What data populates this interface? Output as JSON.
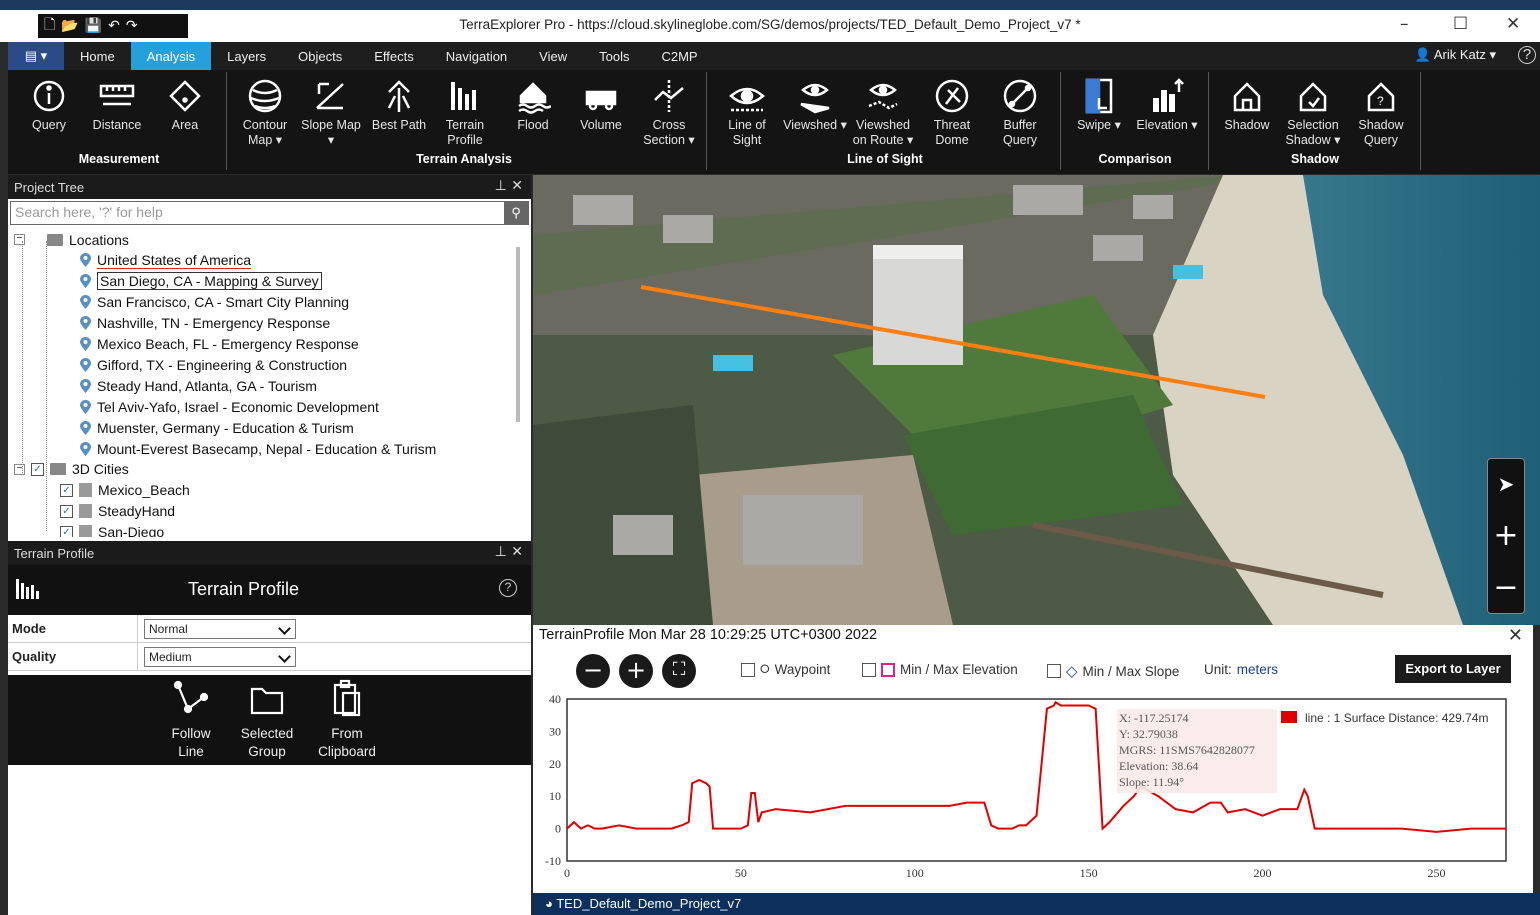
{
  "window": {
    "title": "TerraExplorer Pro - https://cloud.skylineglobe.com/SG/demos/projects/TED_Default_Demo_Project_v7 *",
    "user": "Arik Katz",
    "help": "?"
  },
  "menu": [
    "Home",
    "Analysis",
    "Layers",
    "Objects",
    "Effects",
    "Navigation",
    "View",
    "Tools",
    "C2MP"
  ],
  "ribbon": {
    "buttons": [
      {
        "label": "Query",
        "icon": "info-icon"
      },
      {
        "label": "Distance",
        "icon": "ruler-icon"
      },
      {
        "label": "Area",
        "icon": "area-icon"
      },
      {
        "label": "Contour Map ▾",
        "icon": "contour-icon"
      },
      {
        "label": "Slope Map ▾",
        "icon": "slope-icon"
      },
      {
        "label": "Best Path",
        "icon": "path-icon"
      },
      {
        "label": "Terrain Profile",
        "icon": "profile-icon"
      },
      {
        "label": "Flood",
        "icon": "flood-icon"
      },
      {
        "label": "Volume",
        "icon": "volume-icon"
      },
      {
        "label": "Cross Section ▾",
        "icon": "cross-section-icon"
      },
      {
        "label": "Line of Sight",
        "icon": "eye-icon"
      },
      {
        "label": "Viewshed ▾",
        "icon": "viewshed-icon"
      },
      {
        "label": "Viewshed on Route ▾",
        "icon": "viewshed-route-icon"
      },
      {
        "label": "Threat Dome",
        "icon": "threat-dome-icon"
      },
      {
        "label": "Buffer Query",
        "icon": "buffer-icon"
      },
      {
        "label": "Swipe ▾",
        "icon": "swipe-icon"
      },
      {
        "label": "Elevation ▾",
        "icon": "elevation-icon"
      },
      {
        "label": "Shadow",
        "icon": "shadow-icon"
      },
      {
        "label": "Selection Shadow ▾",
        "icon": "selection-shadow-icon"
      },
      {
        "label": "Shadow Query",
        "icon": "shadow-query-icon"
      }
    ],
    "groups": [
      "Measurement",
      "Terrain Analysis",
      "Line of Sight",
      "Comparison",
      "Shadow"
    ]
  },
  "project_tree": {
    "title": "Project Tree",
    "search_placeholder": "Search here, '?' for help",
    "items": [
      "Locations",
      "United States of America",
      "San Diego, CA - Mapping & Survey",
      "San Francisco, CA - Smart City Planning",
      "Nashville, TN - Emergency Response",
      "Mexico Beach, FL - Emergency Response",
      "Gifford, TX - Engineering & Construction",
      "Steady Hand, Atlanta, GA - Tourism",
      "Tel Aviv-Yafo, Israel - Economic Development",
      "Muenster, Germany - Education & Turism",
      "Mount-Everest Basecamp, Nepal - Education & Turism",
      "3D Cities",
      "Mexico_Beach",
      "SteadyHand",
      "San-Diego"
    ]
  },
  "terrain_panel": {
    "title": "Terrain Profile",
    "heading": "Terrain Profile",
    "mode_label": "Mode",
    "mode_value": "Normal",
    "quality_label": "Quality",
    "quality_value": "Medium",
    "buttons": [
      "Follow Line",
      "Selected Group",
      "From Clipboard"
    ]
  },
  "profile": {
    "title": "TerrainProfile Mon Mar 28 10:29:25 UTC+0300 2022",
    "options": [
      "Waypoint",
      "Min / Max Elevation",
      "Min / Max Slope"
    ],
    "unit_label": "Unit:",
    "unit_value": "meters",
    "export": "Export to Layer",
    "legend": "line : 1 Surface Distance: 429.74m",
    "tooltip": [
      "X: -117.25174",
      "Y: 32.79038",
      "MGRS: 11SMS7642828077",
      "Elevation: 38.64",
      "Slope: 11.94°"
    ]
  },
  "footer": "TED_Default_Demo_Project_v7",
  "chart_data": {
    "type": "line",
    "xlim": [
      0,
      270
    ],
    "ylim": [
      -10,
      40
    ],
    "xticks": [
      "0",
      "50",
      "100",
      "150",
      "200",
      "250"
    ],
    "yticks": [
      "40",
      "30",
      "20",
      "10",
      "0",
      "-10"
    ],
    "series": [
      {
        "name": "line : 1",
        "color": "#e00000",
        "x": [
          0,
          2,
          4,
          6,
          8,
          10,
          15,
          20,
          25,
          30,
          33,
          35,
          36,
          38,
          40,
          41,
          42,
          43,
          44,
          45,
          48,
          50,
          52,
          53,
          54,
          55,
          56,
          60,
          70,
          80,
          90,
          100,
          110,
          115,
          120,
          122,
          124,
          128,
          130,
          132,
          135,
          138,
          140,
          140.5,
          142,
          145,
          148,
          150,
          152,
          154,
          156,
          160,
          163,
          165,
          170,
          175,
          180,
          185,
          188,
          190,
          195,
          200,
          205,
          210,
          212,
          213,
          215,
          220,
          230,
          240,
          250,
          260,
          270
        ],
        "y": [
          0,
          2,
          0,
          1,
          0,
          0,
          1,
          0,
          0,
          0,
          1,
          2,
          14,
          15,
          14,
          13,
          0,
          0,
          0,
          0,
          0,
          0,
          1,
          11,
          11,
          2,
          5,
          6,
          5,
          7,
          7,
          7,
          7,
          8,
          8,
          1,
          0,
          0,
          1,
          1,
          4,
          37,
          38,
          39,
          38,
          38,
          38,
          38,
          37,
          0,
          2,
          7,
          10,
          13,
          10,
          6,
          5,
          8,
          8,
          5,
          6,
          4,
          6,
          6,
          12,
          10,
          0,
          0,
          0,
          0,
          -1,
          0,
          0
        ]
      }
    ]
  }
}
